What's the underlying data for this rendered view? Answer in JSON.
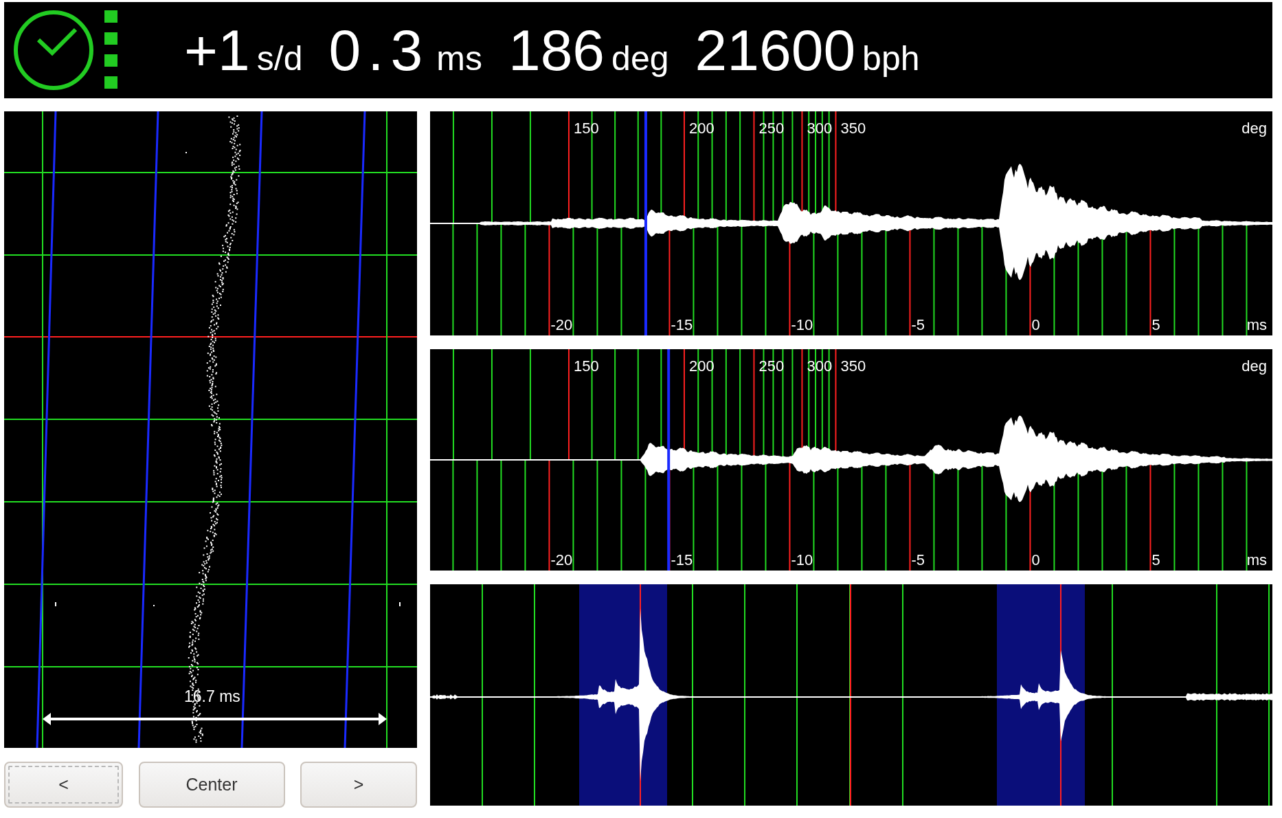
{
  "readings": [
    {
      "value": "+1",
      "unit": "s/d"
    },
    {
      "value": "0.3",
      "unit": "ms"
    },
    {
      "value": "186",
      "unit": "deg"
    },
    {
      "value": "21600",
      "unit": "bph"
    }
  ],
  "paperstrip": {
    "span_label": "16.7 ms"
  },
  "buttons": [
    {
      "label": "<",
      "focused": true
    },
    {
      "label": "Center",
      "focused": false
    },
    {
      "label": ">",
      "focused": false
    }
  ],
  "waveforms": [
    {
      "deg_labels": [
        "150",
        "200",
        "250",
        "300",
        "350"
      ],
      "deg_unit": "deg",
      "ms_labels": [
        "-20",
        "-15",
        "-10",
        "-5",
        "0",
        "5"
      ],
      "ms_unit": "ms"
    },
    {
      "deg_labels": [
        "150",
        "200",
        "250",
        "300",
        "350"
      ],
      "deg_unit": "deg",
      "ms_labels": [
        "-20",
        "-15",
        "-10",
        "-5",
        "0",
        "5"
      ],
      "ms_unit": "ms"
    }
  ]
}
